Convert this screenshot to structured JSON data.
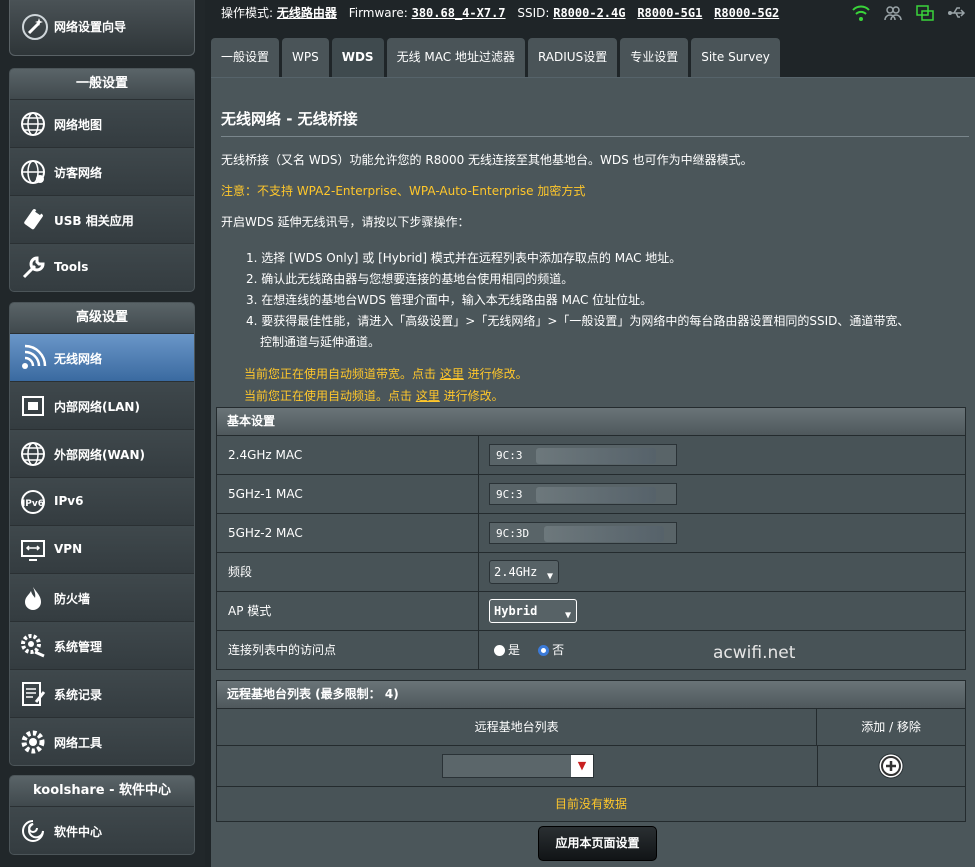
{
  "sidebar": {
    "quick_setup": "网络设置向导",
    "general": {
      "header": "一般设置",
      "items": [
        {
          "label": "网络地图",
          "icon": "globe-map-icon"
        },
        {
          "label": "访客网络",
          "icon": "guest-globe-icon"
        },
        {
          "label": "USB 相关应用",
          "icon": "usb-icon"
        },
        {
          "label": "Tools",
          "icon": "wrench-icon"
        }
      ]
    },
    "advanced": {
      "header": "高级设置",
      "items": [
        {
          "label": "无线网络",
          "icon": "wifi-icon",
          "active": true
        },
        {
          "label": "内部网络(LAN)",
          "icon": "lan-icon"
        },
        {
          "label": "外部网络(WAN)",
          "icon": "wan-globe-icon"
        },
        {
          "label": "IPv6",
          "icon": "ipv6-icon"
        },
        {
          "label": "VPN",
          "icon": "vpn-icon"
        },
        {
          "label": "防火墙",
          "icon": "firewall-icon"
        },
        {
          "label": "系统管理",
          "icon": "gear-admin-icon"
        },
        {
          "label": "系统记录",
          "icon": "log-icon"
        },
        {
          "label": "网络工具",
          "icon": "tools-gear-icon"
        }
      ]
    },
    "koolshare": {
      "header": "koolshare - 软件中心",
      "items": [
        {
          "label": "软件中心",
          "icon": "software-center-icon"
        }
      ]
    }
  },
  "topbar": {
    "mode_label": "操作模式:",
    "mode_value": "无线路由器",
    "fw_label": "Firmware:",
    "fw_value": "380.68_4-X7.7",
    "ssid_label": "SSID:",
    "ssid_1": "R8000-2.4G",
    "ssid_2": "R8000-5G1",
    "ssid_3": "R8000-5G2"
  },
  "tabs": [
    "一般设置",
    "WPS",
    "WDS",
    "无线 MAC 地址过滤器",
    "RADIUS设置",
    "专业设置",
    "Site Survey"
  ],
  "active_tab": "WDS",
  "page": {
    "title": "无线网络 - 无线桥接",
    "intro": "无线桥接（又名 WDS）功能允许您的 R8000 无线连接至其他基地台。WDS 也可作为中继器模式。",
    "notice": "注意：不支持 WPA2-Enterprise、WPA-Auto-Enterprise 加密方式",
    "howto": "开启WDS 延伸无线讯号，请按以下步骤操作：",
    "steps": [
      "1. 选择 [WDS Only] 或 [Hybrid] 模式并在远程列表中添加存取点的 MAC 地址。",
      "2. 确认此无线路由器与您想要连接的基地台使用相同的频道。",
      "3. 在想连线的基地台WDS 管理介面中，输入本无线路由器 MAC 位址位址。",
      "4. 要获得最佳性能，请进入「高级设置」>「无线网络」>「一般设置」为网络中的每台路由器设置相同的SSID、通道带宽、",
      "    控制通道与延伸通道。"
    ],
    "auto_bw_pre": "当前您正在使用自动频道带宽。点击 ",
    "auto_bw_link": "这里",
    "auto_bw_post": " 进行修改。",
    "auto_ch_pre": "当前您正在使用自动频道。点击 ",
    "auto_ch_link": "这里",
    "auto_ch_post": " 进行修改。"
  },
  "basic": {
    "header": "基本设置",
    "mac24_label": "2.4GHz MAC",
    "mac24_value": "9C:3",
    "mac5g1_label": "5GHz-1 MAC",
    "mac5g1_value": "9C:3",
    "mac5g2_label": "5GHz-2 MAC",
    "mac5g2_value": "9C:3D",
    "band_label": "频段",
    "band_value": "2.4GHz",
    "ap_label": "AP 模式",
    "ap_value": "Hybrid",
    "conn_label": "连接列表中的访问点",
    "yes": "是",
    "no": "否",
    "conn_selected": "否"
  },
  "remote": {
    "header": "远程基地台列表 (最多限制： 4)",
    "col_list": "远程基地台列表",
    "col_action": "添加 / 移除",
    "empty": "目前没有数据"
  },
  "watermark": "acwifi.net",
  "apply": "应用本页面设置"
}
